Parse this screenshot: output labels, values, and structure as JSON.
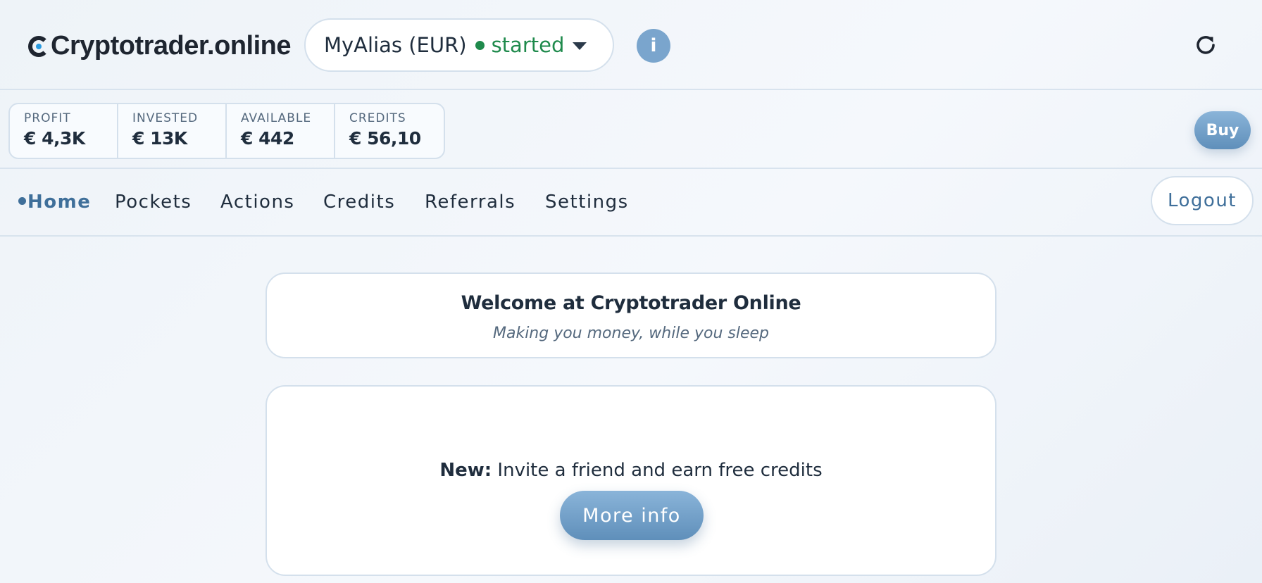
{
  "app": {
    "brand": "Cryptotrader.online",
    "brand_colors": {
      "mark": "#1e2530",
      "dot": "#2a9be0"
    }
  },
  "header": {
    "pocket_alias": "MyAlias (EUR)",
    "pocket_status": "started",
    "status_color": "#1f8a4c",
    "info_label": "i",
    "refresh_icon": "refresh-icon"
  },
  "stats": [
    {
      "label": "PROFIT",
      "value": "€ 4,3K"
    },
    {
      "label": "INVESTED",
      "value": "€ 13K"
    },
    {
      "label": "AVAILABLE",
      "value": "€ 442"
    },
    {
      "label": "CREDITS",
      "value": "€ 56,10"
    }
  ],
  "buy_label": "Buy",
  "nav": {
    "items": [
      {
        "label": "Home",
        "active": true
      },
      {
        "label": "Pockets"
      },
      {
        "label": "Actions"
      },
      {
        "label": "Credits"
      },
      {
        "label": "Referrals"
      },
      {
        "label": "Settings"
      }
    ],
    "logout_label": "Logout"
  },
  "welcome": {
    "title": "Welcome at Cryptotrader Online",
    "subtitle": "Making you money, while you sleep"
  },
  "promo": {
    "prefix": "New:",
    "text": " Invite a friend and earn free credits",
    "button_label": "More info"
  },
  "accent_color": "#3f6f9a"
}
